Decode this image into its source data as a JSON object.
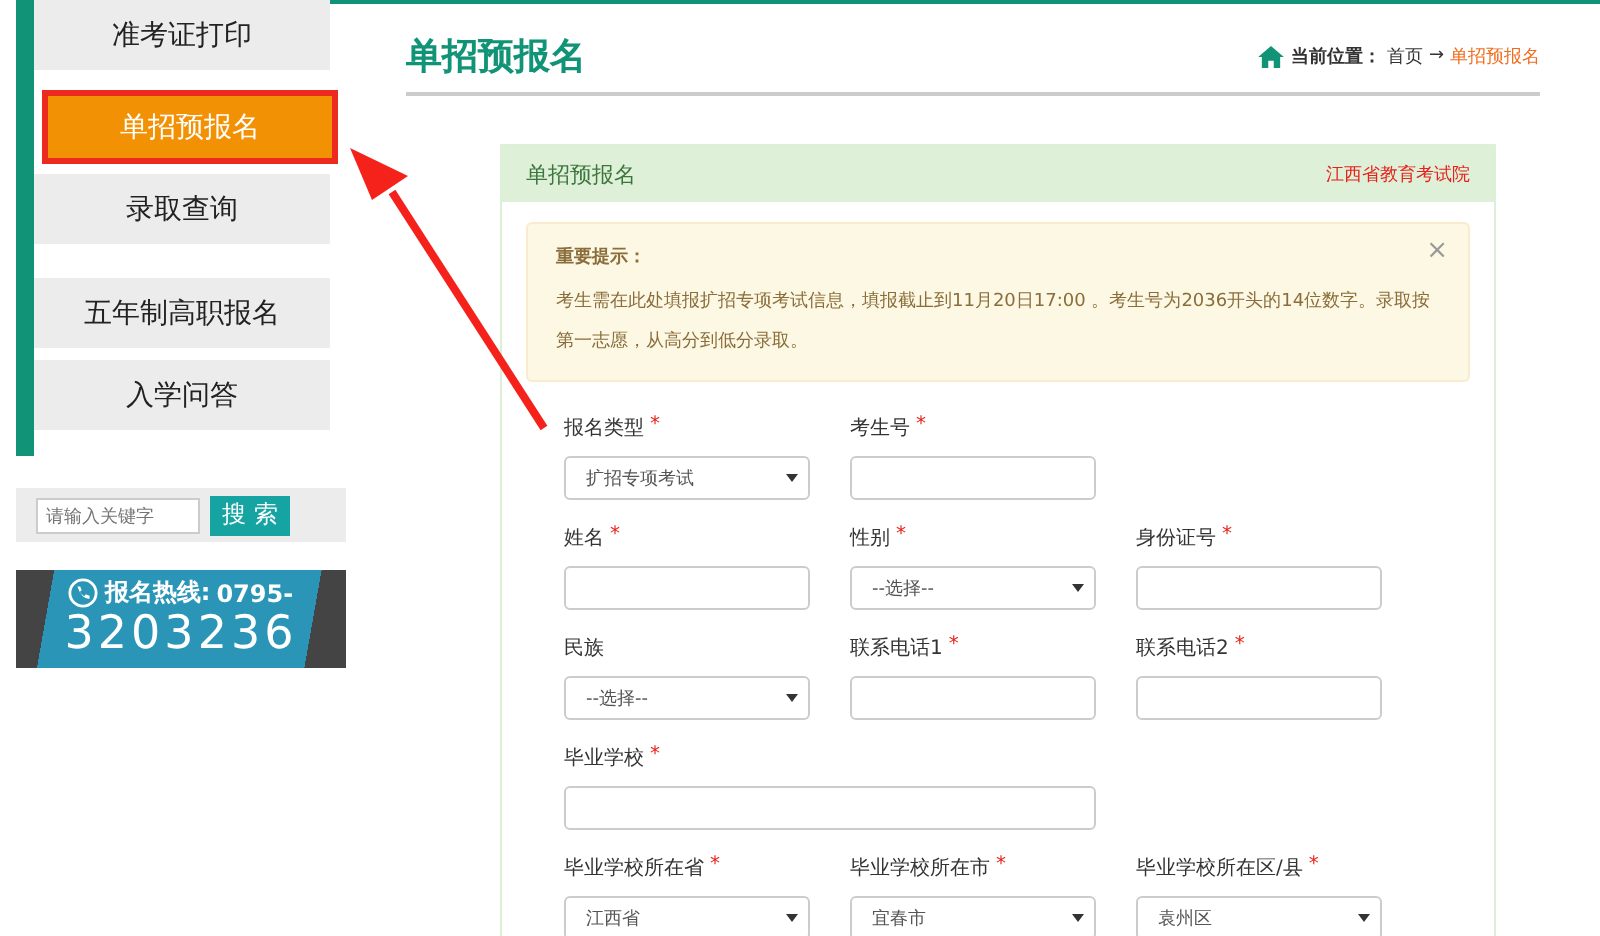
{
  "sidebar": {
    "menu": [
      {
        "label": "准考证打印",
        "selected": false
      },
      {
        "label": "单招预报名",
        "selected": true
      },
      {
        "label": "录取查询",
        "selected": false
      },
      {
        "label": "五年制高职报名",
        "selected": false
      },
      {
        "label": "入学问答",
        "selected": false
      }
    ],
    "search": {
      "placeholder": "请输入关键字",
      "button": "搜 索"
    },
    "hotline": {
      "label": "报名热线:",
      "number_head": "0795-",
      "number": "3203236"
    }
  },
  "page_title": "单招预报名",
  "breadcrumb": {
    "prefix": "当前位置：",
    "home": "首页",
    "arrow": "→",
    "current": "单招预报名"
  },
  "panel": {
    "title": "单招预报名",
    "org": "江西省教育考试院",
    "alert": {
      "title": "重要提示：",
      "text": "考生需在此处填报扩招专项考试信息，填报截止到11月20日17:00 。考生号为2036开头的14位数字。录取按第一志愿，从高分到低分录取。",
      "close": "×"
    },
    "rows": [
      [
        {
          "label": "报名类型",
          "required_mark": "*",
          "kind": "select",
          "value": "扩招专项考试"
        },
        {
          "label": "考生号",
          "required_mark": "*",
          "kind": "input"
        }
      ],
      [
        {
          "label": "姓名",
          "required_mark": "*",
          "kind": "input"
        },
        {
          "label": "性别",
          "required_mark": "*",
          "kind": "select",
          "value": "--选择--"
        },
        {
          "label": "身份证号",
          "required_mark": "*",
          "kind": "input"
        }
      ],
      [
        {
          "label": "民族",
          "kind": "select",
          "value": "--选择--"
        },
        {
          "label": "联系电话1",
          "required_mark": "*",
          "kind": "input"
        },
        {
          "label": "联系电话2",
          "required_mark": "*",
          "kind": "input"
        }
      ],
      [
        {
          "label": "毕业学校",
          "required_mark": "*",
          "kind": "wide-input"
        }
      ],
      [
        {
          "label": "毕业学校所在省",
          "required_mark": "*",
          "kind": "select",
          "value": "江西省"
        },
        {
          "label": "毕业学校所在市",
          "required_mark": "*",
          "kind": "select",
          "value": "宜春市"
        },
        {
          "label": "毕业学校所在区/县",
          "required_mark": "*",
          "kind": "select",
          "value": "袁州区"
        }
      ]
    ]
  }
}
